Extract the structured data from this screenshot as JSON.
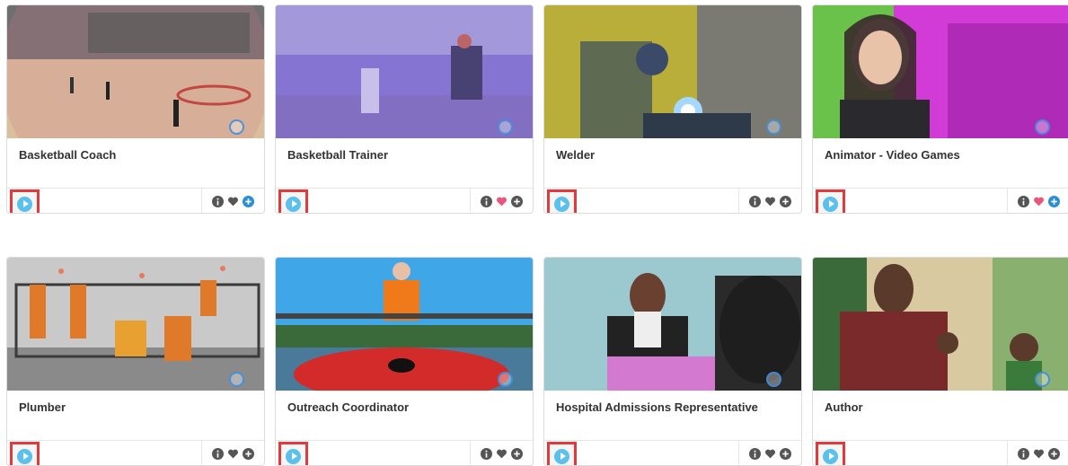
{
  "cards": [
    {
      "title": "Basketball Coach",
      "favorited": false
    },
    {
      "title": "Basketball Trainer",
      "favorited": true
    },
    {
      "title": "Welder",
      "favorited": false
    },
    {
      "title": "Animator - Video Games",
      "favorited": true
    },
    {
      "title": "Plumber",
      "favorited": false
    },
    {
      "title": "Outreach Coordinator",
      "favorited": false
    },
    {
      "title": "Hospital Admissions Representative",
      "favorited": false
    },
    {
      "title": "Author",
      "favorited": false
    }
  ],
  "colors": {
    "play_accent": "#5bc0eb",
    "highlight_border": "#e03a3a",
    "heart_active": "#e8567e",
    "icon_default": "#555555",
    "plus_icon": "#2a8fd6"
  }
}
